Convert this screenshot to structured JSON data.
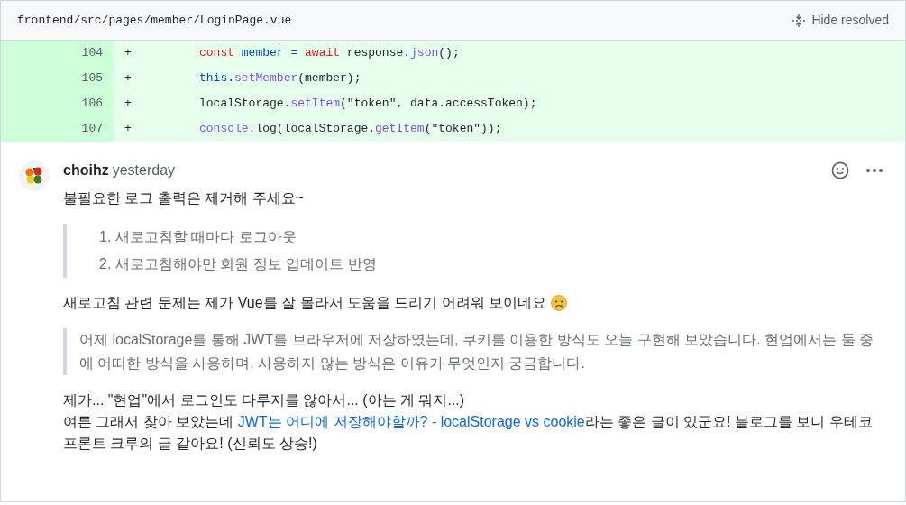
{
  "file_header": {
    "path": "frontend/src/pages/member/LoginPage.vue",
    "hide_resolved": "Hide resolved"
  },
  "diff_lines": [
    {
      "number": "104",
      "sign": "+",
      "tokens": [
        {
          "kind": "keyword",
          "text": "const"
        },
        {
          "kind": "variable",
          "text": " member = "
        },
        {
          "kind": "keyword",
          "text": "await"
        },
        {
          "kind": "plain",
          "text": " response."
        },
        {
          "kind": "function",
          "text": "json"
        },
        {
          "kind": "plain",
          "text": "();"
        }
      ]
    },
    {
      "number": "105",
      "sign": "+",
      "tokens": [
        {
          "kind": "variable",
          "text": "this"
        },
        {
          "kind": "plain",
          "text": "."
        },
        {
          "kind": "function",
          "text": "setMember"
        },
        {
          "kind": "plain",
          "text": "(member);"
        }
      ]
    },
    {
      "number": "106",
      "sign": "+",
      "tokens": [
        {
          "kind": "plain",
          "text": "localStorage."
        },
        {
          "kind": "function",
          "text": "setItem"
        },
        {
          "kind": "plain",
          "text": "(\"token\", data.accessToken);"
        }
      ]
    },
    {
      "number": "107",
      "sign": "+",
      "tokens": [
        {
          "kind": "function",
          "text": "console"
        },
        {
          "kind": "plain",
          "text": ".log(localStorage."
        },
        {
          "kind": "function",
          "text": "getItem"
        },
        {
          "kind": "plain",
          "text": "(\"token\"));"
        }
      ]
    }
  ],
  "comment": {
    "author": "choihz",
    "time": "yesterday",
    "body": [
      {
        "kind": "paragraph",
        "parts": [
          {
            "kind": "text",
            "text": "불필요한 로그 출력은 제거해 주세요~"
          }
        ]
      },
      {
        "kind": "quote_list",
        "items": [
          "1. 새로고침할 때마다 로그아웃",
          "2. 새로고침해야만 회원 정보 업데이트 반영"
        ]
      },
      {
        "kind": "paragraph",
        "parts": [
          {
            "kind": "text",
            "text": "새로고침 관련 문제는 제가 Vue를 잘 몰라서 도움을 드리기 어려워 보이네요"
          },
          {
            "kind": "emoji"
          }
        ]
      },
      {
        "kind": "quote",
        "text": "어제 localStorage를 통해 JWT를 브라우저에 저장하였는데, 쿠키를 이용한 방식도 오늘 구현해 보았습니다. 현업에서는 둘 중에 어떠한 방식을 사용하며, 사용하지 않는 방식은 이유가 무엇인지 궁금합니다."
      },
      {
        "kind": "paragraph",
        "parts": [
          {
            "kind": "text",
            "text": "제가... \"현업\"에서 로그인도 다루지를 않아서... (아는 게 뭐지...)"
          },
          {
            "kind": "break"
          },
          {
            "kind": "text",
            "text": "여튼 그래서 찾아 보았는데 "
          },
          {
            "kind": "link",
            "text": "JWT는 어디에 저장해야할까? - localStorage vs cookie"
          },
          {
            "kind": "text",
            "text": "라는 좋은 글이 있군요! 블로그를 보니 우테코 프론트 크루의 글 같아요! (신뢰도 상승!)"
          }
        ]
      }
    ]
  }
}
